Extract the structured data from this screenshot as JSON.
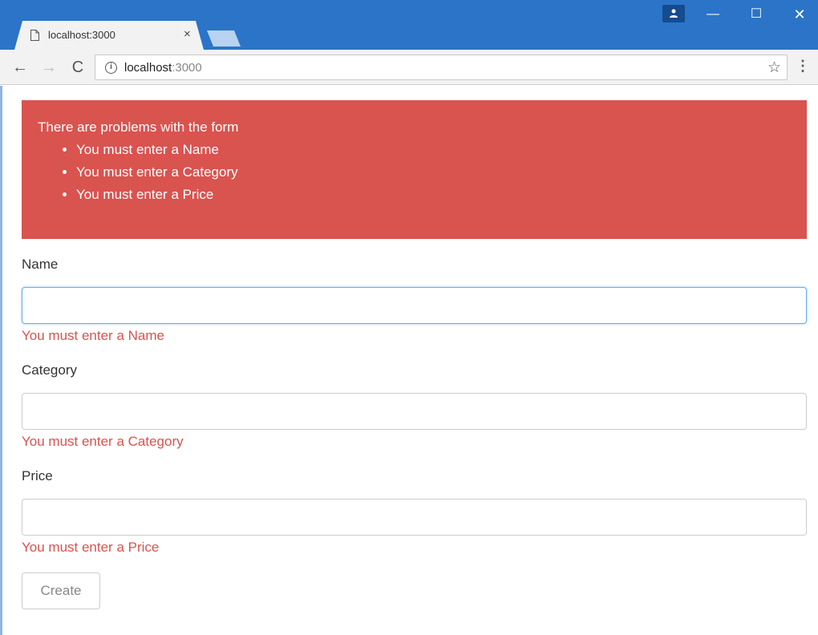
{
  "browser": {
    "tab_title": "localhost:3000",
    "tab_close": "×",
    "url_host": "localhost",
    "url_port": ":3000",
    "back": "←",
    "forward": "→",
    "reload": "C",
    "star": "☆",
    "menu": "⋮",
    "win_min": "—",
    "win_max": "☐",
    "win_close": "✕"
  },
  "alert": {
    "title": "There are problems with the form",
    "items": [
      "You must enter a Name",
      "You must enter a Category",
      "You must enter a Price"
    ]
  },
  "form": {
    "fields": [
      {
        "label": "Name",
        "value": "",
        "error": "You must enter a Name"
      },
      {
        "label": "Category",
        "value": "",
        "error": "You must enter a Category"
      },
      {
        "label": "Price",
        "value": "",
        "error": "You must enter a Price"
      }
    ],
    "submit_label": "Create"
  },
  "colors": {
    "titlebar": "#2b74c8",
    "alert_background": "#d9534f",
    "error_text": "#d9534f",
    "focus_border": "#66afe9"
  }
}
